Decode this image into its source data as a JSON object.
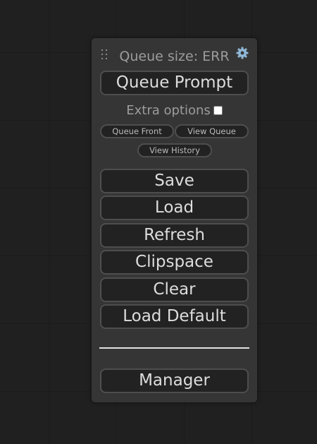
{
  "menu": {
    "queue_size_label": "Queue size: ERR",
    "queue_prompt_label": "Queue Prompt",
    "extra_options_label": "Extra options",
    "extra_options_checked": false,
    "queue_front_label": "Queue Front",
    "view_queue_label": "View Queue",
    "view_history_label": "View History",
    "save_label": "Save",
    "load_label": "Load",
    "refresh_label": "Refresh",
    "clipspace_label": "Clipspace",
    "clear_label": "Clear",
    "load_default_label": "Load Default",
    "manager_label": "Manager"
  },
  "icons": {
    "drag_handle": "drag-handle-icon",
    "settings": "gear-icon"
  },
  "colors": {
    "canvas_background": "#202020",
    "panel_background": "#353535",
    "button_background": "#222222",
    "button_border": "#4e4e4e",
    "button_text": "#dddddd",
    "muted_text": "#9c9c9c",
    "gear_accent": "#8fb7d6"
  }
}
